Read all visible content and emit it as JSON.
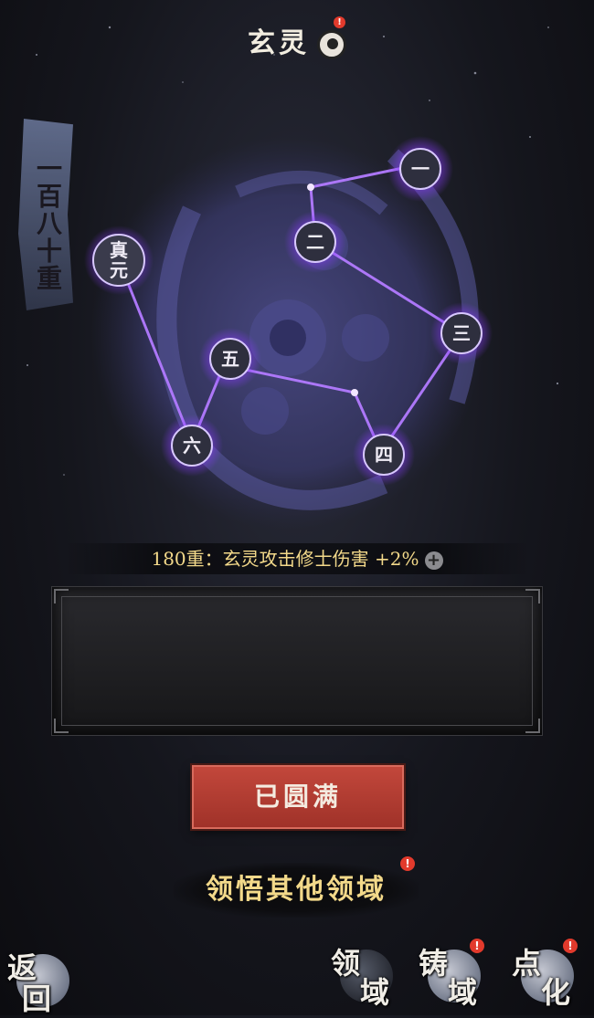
{
  "title": {
    "text": "玄灵",
    "badge": "!"
  },
  "rank_label": "一百八十重",
  "nodes": [
    {
      "id": "zhenyuan",
      "label": "真元",
      "label_line2": ""
    },
    {
      "id": "n1",
      "label": "一"
    },
    {
      "id": "n2",
      "label": "二"
    },
    {
      "id": "n3",
      "label": "三"
    },
    {
      "id": "n4",
      "label": "四"
    },
    {
      "id": "n5",
      "label": "五"
    },
    {
      "id": "n6",
      "label": "六"
    }
  ],
  "stat": {
    "text": "180重：玄灵攻击修士伤害 +2%",
    "plus": "+"
  },
  "description": "",
  "complete_button": "已圆满",
  "other_domains_button": {
    "label": "领悟其他领域",
    "badge": "!"
  },
  "nav": {
    "back": {
      "ch1": "返",
      "ch2": "回"
    },
    "domain": {
      "ch1": "领",
      "ch2": "域"
    },
    "forge": {
      "ch1": "铸",
      "ch2": "域",
      "badge": "!"
    },
    "refine": {
      "ch1": "点",
      "ch2": "化",
      "badge": "!"
    }
  },
  "colors": {
    "accent_gold": "#f3d98a",
    "glow_purple": "#b36dff",
    "button_red": "#b23a30",
    "badge_red": "#e23a2c"
  }
}
